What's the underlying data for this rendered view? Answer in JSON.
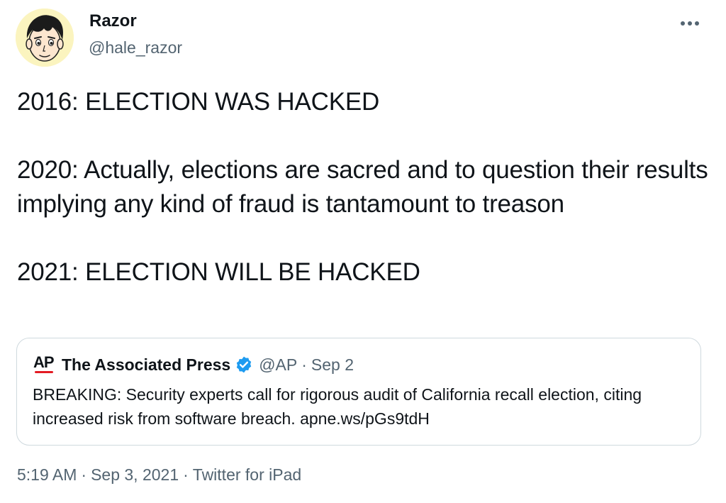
{
  "author": {
    "name": "Razor",
    "handle": "@hale_razor"
  },
  "tweet": {
    "text": "2016: ELECTION WAS HACKED\n\n2020: Actually, elections are sacred and to question their results implying any kind of fraud is tantamount to treason\n\n2021: ELECTION WILL BE HACKED"
  },
  "quote": {
    "logo_text": "AP",
    "name": "The Associated Press",
    "handle": "@AP",
    "separator": "·",
    "date": "Sep 2",
    "text": "BREAKING: Security experts call for rigorous audit of California recall election, citing increased risk from software breach. apne.ws/pGs9tdH"
  },
  "meta": {
    "time": "5:19 AM",
    "separator": "·",
    "date": "Sep 3, 2021",
    "source": "Twitter for iPad"
  },
  "icons": {
    "more": "more-horizontal-icon",
    "verified": "verified-badge-icon"
  },
  "colors": {
    "text_primary": "#0f1419",
    "text_secondary": "#536471",
    "border": "#cfd9de",
    "verified_blue": "#1d9bf0",
    "ap_red": "#e31b23",
    "avatar_bg": "#fbf4bf"
  }
}
